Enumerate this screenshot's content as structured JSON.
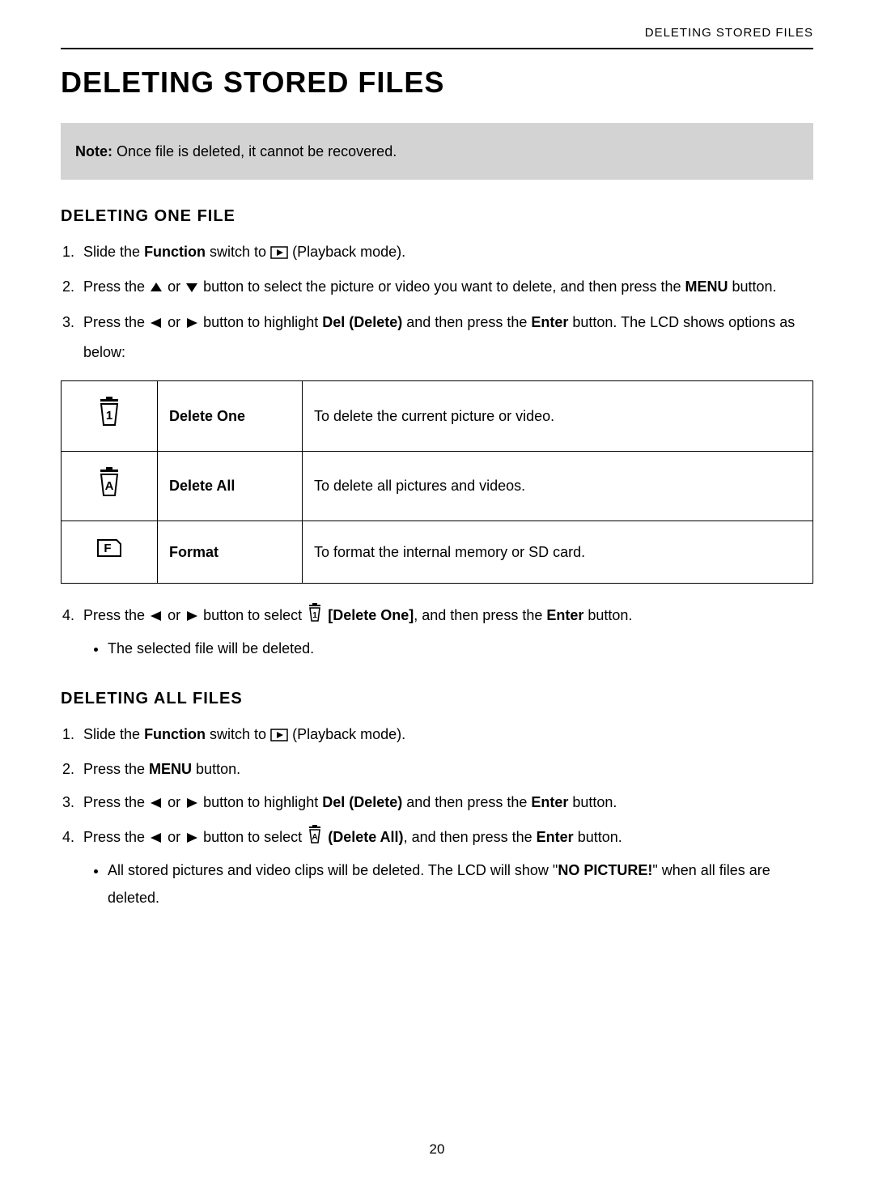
{
  "header": {
    "right": "DELETING STORED FILES"
  },
  "title": "DELETING STORED FILES",
  "note": {
    "label": "Note:",
    "text": " Once file is deleted, it cannot be recovered."
  },
  "section1": {
    "heading": "DELETING ONE FILE",
    "step1": {
      "a": "Slide the ",
      "b": "Function",
      "c": " switch to ",
      "d": " (Playback mode)."
    },
    "step2": {
      "a": "Press the ",
      "b": " or ",
      "c": " button to select the picture or video you want to delete, and then press the ",
      "d": "MENU",
      "e": " button."
    },
    "step3": {
      "a": "Press the ",
      "b": " or ",
      "c": " button to highlight ",
      "d": "Del (Delete)",
      "e": " and then press the ",
      "f": "Enter",
      "g": " button. The LCD shows options as below:"
    },
    "step4": {
      "a": "Press the ",
      "b": " or ",
      "c": " button to select ",
      "d": " [Delete One]",
      "e": ", and then press the ",
      "f": "Enter",
      "g": " button."
    },
    "step4sub": "The selected file will be deleted."
  },
  "table": {
    "row1": {
      "label": "Delete One",
      "desc": "To delete the current picture or video."
    },
    "row2": {
      "label": "Delete All",
      "desc": "To delete all pictures and videos."
    },
    "row3": {
      "label": "Format",
      "desc": "To format the internal memory or SD card."
    }
  },
  "section2": {
    "heading": "DELETING ALL FILES",
    "step1": {
      "a": "Slide the ",
      "b": "Function",
      "c": " switch to ",
      "d": " (Playback mode)."
    },
    "step2": {
      "a": "Press the ",
      "b": "MENU",
      "c": " button."
    },
    "step3": {
      "a": "Press the ",
      "b": " or ",
      "c": " button to highlight ",
      "d": "Del (Delete)",
      "e": " and then press the ",
      "f": "Enter",
      "g": " button."
    },
    "step4": {
      "a": "Press the ",
      "b": " or ",
      "c": " button to select ",
      "d": " (Delete All)",
      "e": ", and then press the ",
      "f": "Enter",
      "g": " button."
    },
    "step4sub": {
      "a": "All stored pictures and video clips will be deleted. The LCD will show \"",
      "b": "NO PICTURE!",
      "c": "\" when all files are deleted."
    }
  },
  "page_number": "20"
}
